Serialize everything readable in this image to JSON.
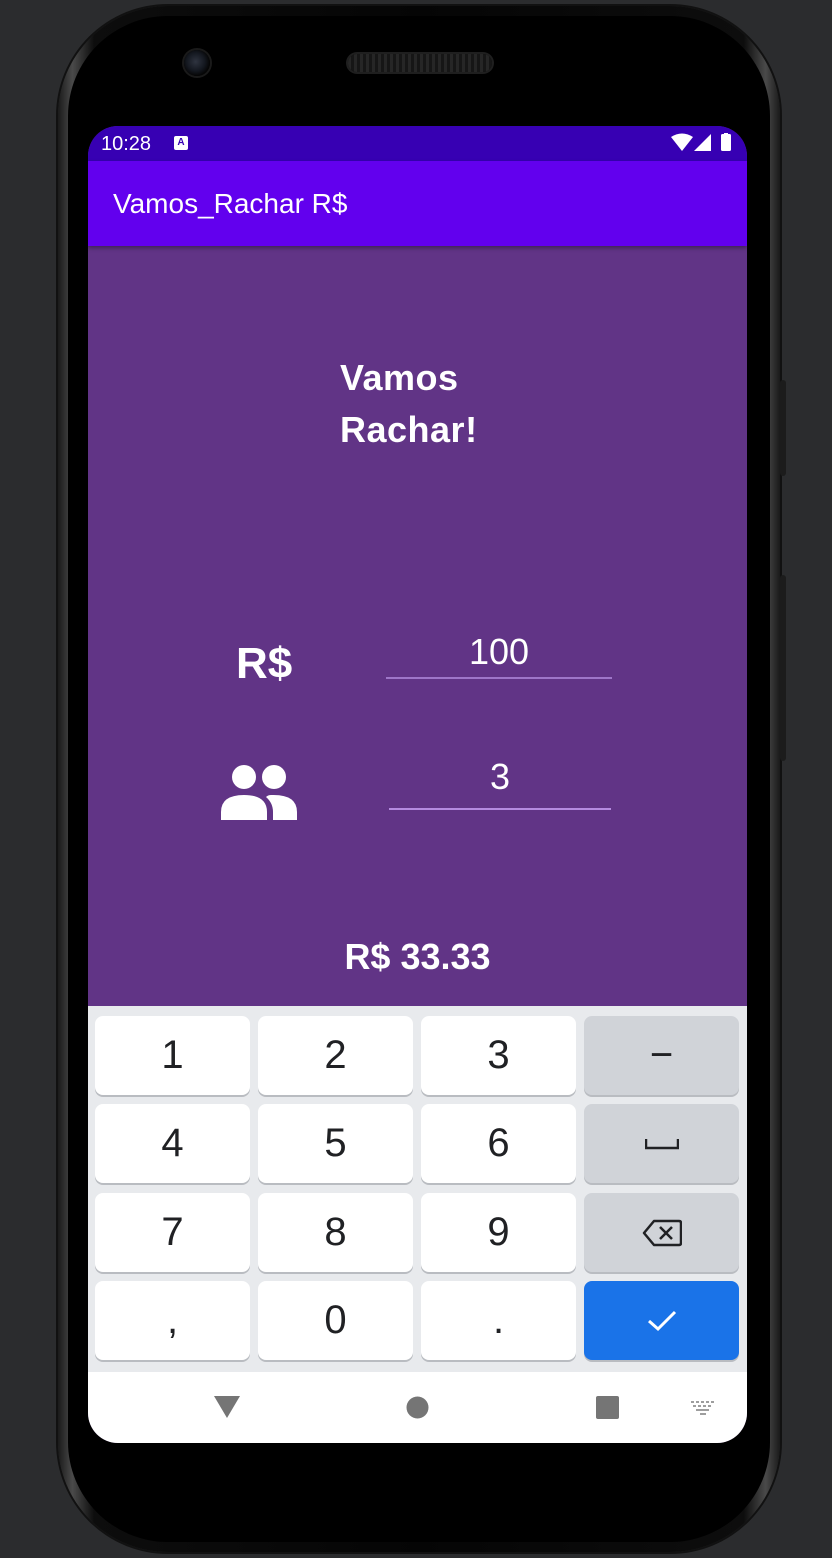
{
  "status_bar": {
    "time": "10:28",
    "notification_icon": "a-icon",
    "icons": [
      "wifi-icon",
      "signal-icon",
      "battery-icon"
    ]
  },
  "app_bar": {
    "title": "Vamos_Rachar R$"
  },
  "main": {
    "headline_line1": "Vamos",
    "headline_line2": "Rachar!",
    "amount_label": "R$",
    "amount_value": "100",
    "people_icon": "people-icon",
    "people_value": "3",
    "result": "R$ 33.33"
  },
  "keyboard": {
    "keys": {
      "k1": "1",
      "k2": "2",
      "k3": "3",
      "minus": "−",
      "k4": "4",
      "k5": "5",
      "k6": "6",
      "k7": "7",
      "k8": "8",
      "k9": "9",
      "comma": ",",
      "k0": "0",
      "dot": "."
    },
    "function_keys": [
      "space-icon",
      "backspace-icon",
      "check-icon"
    ]
  },
  "navigation_bar": {
    "icons": [
      "back-icon",
      "home-icon",
      "recents-icon",
      "keyboard-icon"
    ]
  },
  "colors": {
    "status_bar": "#3700b3",
    "app_bar": "#6200ee",
    "background": "#613486",
    "underline_amount": "#9e76c8",
    "underline_people": "#b58be0",
    "enter_key": "#1a73e8"
  }
}
